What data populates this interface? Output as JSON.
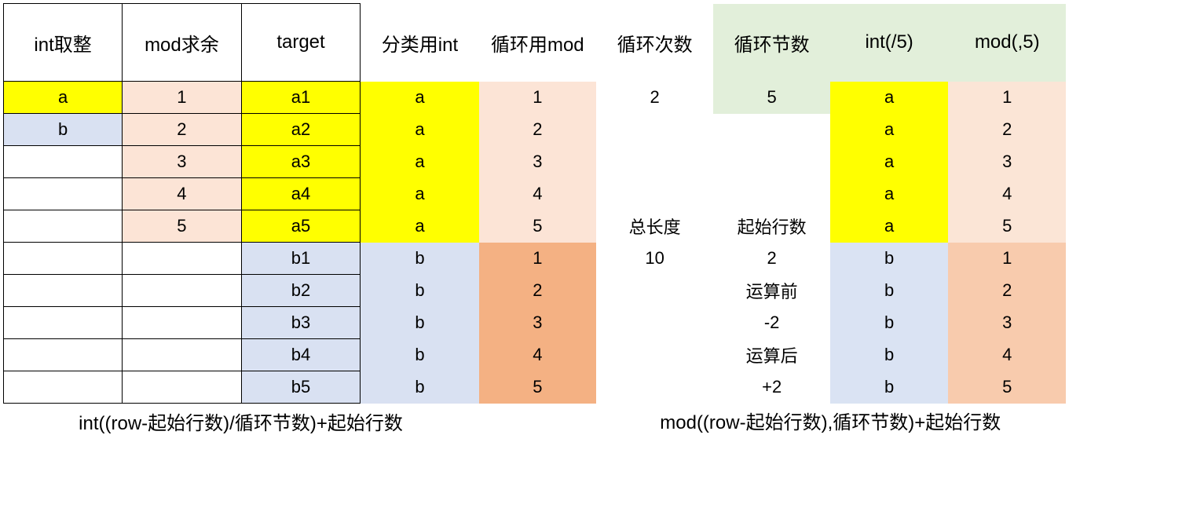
{
  "headers": {
    "c1": "int取整",
    "c2": "mod求余",
    "c3": "target",
    "c4": "分类用int",
    "c5": "循环用mod",
    "c6": "循环次数",
    "c7": "循环节数",
    "c8": "int(/5)",
    "c9": "mod(,5)"
  },
  "rows": [
    {
      "c1": "a",
      "c2": "1",
      "c3": "a1",
      "c4": "a",
      "c5": "1",
      "c6": "2",
      "c7": "5",
      "c8": "a",
      "c9": "1"
    },
    {
      "c1": "b",
      "c2": "2",
      "c3": "a2",
      "c4": "a",
      "c5": "2",
      "c6": "",
      "c7": "",
      "c8": "a",
      "c9": "2"
    },
    {
      "c1": "",
      "c2": "3",
      "c3": "a3",
      "c4": "a",
      "c5": "3",
      "c6": "",
      "c7": "",
      "c8": "a",
      "c9": "3"
    },
    {
      "c1": "",
      "c2": "4",
      "c3": "a4",
      "c4": "a",
      "c5": "4",
      "c6": "",
      "c7": "",
      "c8": "a",
      "c9": "4"
    },
    {
      "c1": "",
      "c2": "5",
      "c3": "a5",
      "c4": "a",
      "c5": "5",
      "c6": "总长度",
      "c7": "起始行数",
      "c8": "a",
      "c9": "5"
    },
    {
      "c1": "",
      "c2": "",
      "c3": "b1",
      "c4": "b",
      "c5": "1",
      "c6": "10",
      "c7": "2",
      "c8": "b",
      "c9": "1"
    },
    {
      "c1": "",
      "c2": "",
      "c3": "b2",
      "c4": "b",
      "c5": "2",
      "c6": "",
      "c7": "运算前",
      "c8": "b",
      "c9": "2"
    },
    {
      "c1": "",
      "c2": "",
      "c3": "b3",
      "c4": "b",
      "c5": "3",
      "c6": "",
      "c7": "-2",
      "c8": "b",
      "c9": "3"
    },
    {
      "c1": "",
      "c2": "",
      "c3": "b4",
      "c4": "b",
      "c5": "4",
      "c6": "",
      "c7": "运算后",
      "c8": "b",
      "c9": "4"
    },
    {
      "c1": "",
      "c2": "",
      "c3": "b5",
      "c4": "b",
      "c5": "5",
      "c6": "",
      "c7": "+2",
      "c8": "b",
      "c9": "5"
    }
  ],
  "formulas": {
    "left": "int((row-起始行数)/循环节数)+起始行数",
    "right": "mod((row-起始行数),循环节数)+起始行数"
  }
}
